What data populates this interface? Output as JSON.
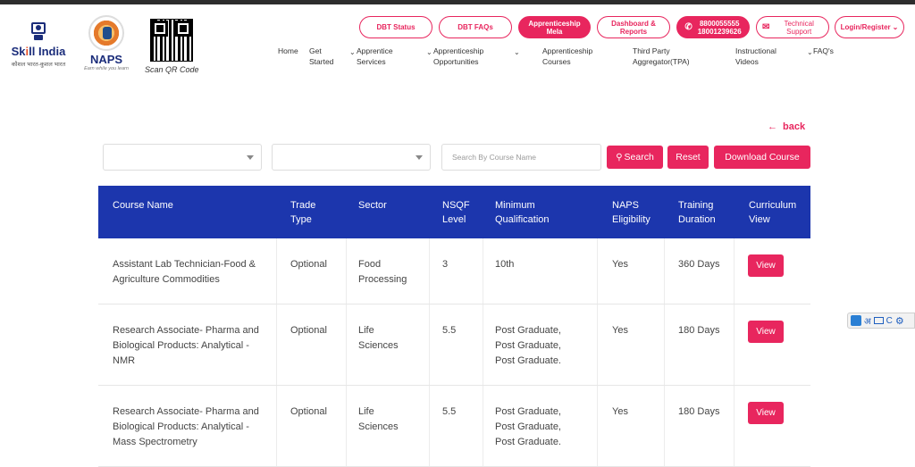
{
  "header": {
    "skill_logo": {
      "title_start": "Sk",
      "title_i": "i",
      "title_end": "ll India",
      "subtitle": "कौशल भारत-कुशल भारत"
    },
    "naps_logo": {
      "name": "NAPS",
      "tagline": "Earn while you learn"
    },
    "qr": {
      "caption": "Scan QR Code"
    },
    "pills": [
      {
        "label": "DBT Status"
      },
      {
        "label": "DBT FAQs"
      },
      {
        "label": "Apprenticeship Mela"
      },
      {
        "label": "Dashboard & Reports"
      },
      {
        "line1": "8800055555",
        "line2": "18001239626"
      },
      {
        "label": "Technical Support"
      },
      {
        "label": "Login/Register"
      }
    ],
    "nav": [
      {
        "label": "Home"
      },
      {
        "label": "Get Started"
      },
      {
        "label": "Apprentice Services"
      },
      {
        "label": "Apprenticeship Opportunities"
      },
      {
        "label": "Apprenticeship Courses"
      },
      {
        "label": "Third Party Aggregator(TPA)"
      },
      {
        "label": "Instructional Videos"
      },
      {
        "label": "FAQ's"
      }
    ]
  },
  "filters": {
    "back_label": "back",
    "search_placeholder": "Search By Course Name",
    "search_button": "Search",
    "reset_button": "Reset",
    "download_button": "Download Course"
  },
  "table": {
    "columns": [
      "Course Name",
      "Trade Type",
      "Sector",
      "NSQF Level",
      "Minimum Qualification",
      "NAPS Eligibility",
      "Training Duration",
      "Curriculum View"
    ],
    "rows": [
      {
        "course_name": "Assistant Lab Technician-Food & Agriculture Commodities",
        "trade_type": "Optional",
        "sector": "Food Processing",
        "nsqf_level": "3",
        "qualification": [
          "10th"
        ],
        "naps_eligibility": "Yes",
        "duration": "360 Days",
        "view_label": "View"
      },
      {
        "course_name": "Research Associate- Pharma and Biological Products: Analytical - NMR",
        "trade_type": "Optional",
        "sector": "Life Sciences",
        "nsqf_level": "5.5",
        "qualification": [
          "Post Graduate,",
          "Post Graduate,",
          "Post Graduate."
        ],
        "naps_eligibility": "Yes",
        "duration": "180 Days",
        "view_label": "View"
      },
      {
        "course_name": "Research Associate- Pharma and Biological Products: Analytical - Mass Spectrometry",
        "trade_type": "Optional",
        "sector": "Life Sciences",
        "nsqf_level": "5.5",
        "qualification": [
          "Post Graduate,",
          "Post Graduate,",
          "Post Graduate."
        ],
        "naps_eligibility": "Yes",
        "duration": "180 Days",
        "view_label": "View"
      }
    ]
  },
  "widget": {
    "letters": "अ",
    "letter2": "C"
  },
  "colors": {
    "accent": "#e8265e",
    "table_header": "#1c36ad",
    "brand_blue": "#1a2c7a"
  },
  "icons": {
    "back": "arrow-left-icon",
    "search": "search-icon",
    "phone": "phone-icon",
    "mail": "mail-icon",
    "chevron": "chevron-down-icon",
    "gear": "gear-icon"
  }
}
